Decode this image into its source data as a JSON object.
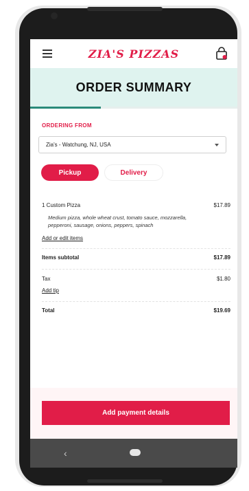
{
  "header": {
    "brand": "ZIA'S PIZZAS",
    "title": "ORDER SUMMARY",
    "progress": 0.34
  },
  "ordering": {
    "label": "ORDERING FROM",
    "location": "Zia's - Watchung, NJ, USA"
  },
  "toggle": {
    "pickup": "Pickup",
    "delivery": "Delivery"
  },
  "items": [
    {
      "name": "1  Custom Pizza",
      "price": "$17.89",
      "description": "Medium pizza, whole wheat crust, tomato sauce, mozzarella, pepperoni, sausage, onions, peppers, spinach"
    }
  ],
  "links": {
    "edit_items": "Add or edit items",
    "add_tip": "Add tip"
  },
  "summary": {
    "subtotal_label": "Items subtotal",
    "subtotal_value": "$17.89",
    "tax_label": "Tax",
    "tax_value": "$1.80",
    "total_label": "Total",
    "total_value": "$19.69"
  },
  "footer": {
    "pay_label": "Add payment details"
  },
  "nav": {
    "back": "‹"
  },
  "colors": {
    "accent": "#e11d48",
    "band": "#dff3ef",
    "progress": "#2a8a7a"
  },
  "icons": {
    "menu": "menu-icon",
    "bag": "shopping-bag-icon",
    "caret": "chevron-down-icon"
  }
}
